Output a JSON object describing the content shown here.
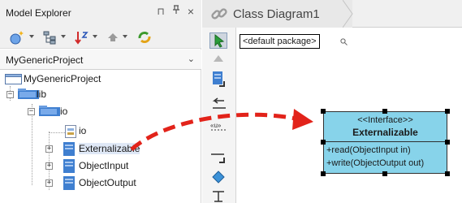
{
  "explorer": {
    "title": "Model Explorer",
    "pin_glyph": "⊓",
    "float_glyph": "ᚴ",
    "close_glyph": "×",
    "project_selector": {
      "value": "MyGenericProject",
      "chevron": "⌄"
    },
    "tree": {
      "root": "MyGenericProject",
      "lib": "lib",
      "io": "io",
      "io_child": "io",
      "externalizable": "Externalizable",
      "object_input": "ObjectInput",
      "object_output": "ObjectOutput"
    },
    "expander_minus": "−",
    "expander_plus": "+"
  },
  "diagram": {
    "tab_label": "Class Diagram1",
    "package": "<default package>",
    "search_glyph": "🔍"
  },
  "class_box": {
    "stereotype": "<<Interface>>",
    "name": "Externalizable",
    "operations": [
      "+read(ObjectInput in)",
      "+write(ObjectOutput out)"
    ]
  },
  "colors": {
    "class_fill": "#87d3ea",
    "drag_arrow": "#e2231a",
    "folder_blue": "#3f7fd0",
    "selection": "#dfe8f6"
  },
  "icons": {
    "toolbar": [
      "new-model-element-icon",
      "tree-filter-icon",
      "sort-icon",
      "up-icon",
      "refresh-icon"
    ],
    "palette": [
      "select-pointer-icon",
      "scroll-up-icon",
      "class-tool-icon",
      "interface-tool-icon",
      "enumeration-tool-icon",
      "association-tool-icon",
      "realization-tool-icon",
      "diamond-tool-icon",
      "dependency-tool-icon"
    ]
  }
}
